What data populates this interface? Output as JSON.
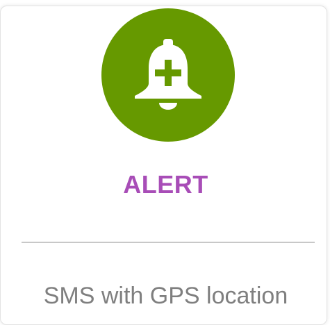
{
  "card": {
    "title": "ALERT",
    "subtitle": "SMS with GPS location",
    "icon": "bell-plus-icon"
  },
  "colors": {
    "icon_background": "#669900",
    "title": "#a84db7",
    "subtitle": "#7f7f7f",
    "divider": "#c8c8c8"
  }
}
